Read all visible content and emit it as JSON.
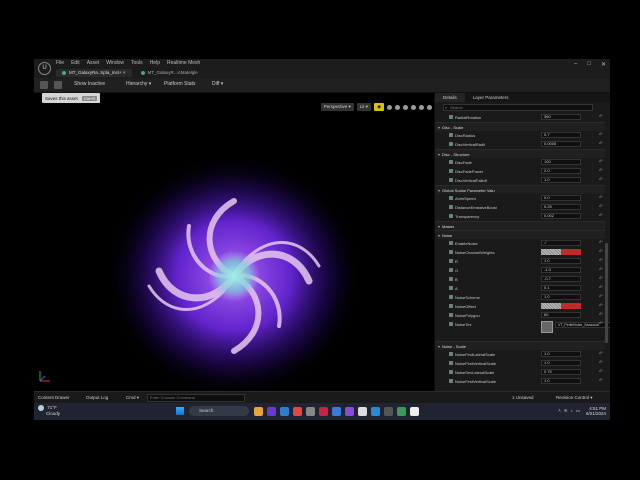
{
  "menu": [
    "File",
    "Edit",
    "Asset",
    "Window",
    "Tools",
    "Help",
    "Realtime Mesh"
  ],
  "doc_tabs": [
    {
      "label": "MT_GalaxyRa..Spla_Inst+ ×",
      "active": true
    },
    {
      "label": "MT_GalaxyR...icMatelgle",
      "active": false
    }
  ],
  "toolbar": {
    "show_inactive": "Show Inactive",
    "hierarchy": "Hierarchy ▾",
    "platform_stats": "Platform Stats",
    "diff": "Diff ▾"
  },
  "tooltip": {
    "text": "Saves this asset",
    "shortcut": "Ctrl+S"
  },
  "viewport": {
    "perspective": "Perspective ▾",
    "lit": "Lit ▾"
  },
  "bottombar": {
    "content_drawer": "Content Drawer",
    "output_log": "Output Log",
    "cmd": "Cmd ▾",
    "cmd_placeholder": "Enter Console Command",
    "unsaved": "1 Unsaved",
    "revision": "Revision Control ▾"
  },
  "panel": {
    "tabs": [
      "Details",
      "Layer Parameters"
    ],
    "search_placeholder": "Search",
    "rows": [
      {
        "kind": "param",
        "label": "RadialRotation",
        "value": "360"
      },
      {
        "kind": "section",
        "label": "Disc - Scale"
      },
      {
        "kind": "param",
        "label": "DiscRadius",
        "value": "0.7"
      },
      {
        "kind": "param",
        "label": "DiscVerticalRadii",
        "value": "0.0005"
      },
      {
        "kind": "section",
        "label": "Disc - Structure"
      },
      {
        "kind": "param",
        "label": "DiscFade",
        "value": "100"
      },
      {
        "kind": "param",
        "label": "DiscFadePower",
        "value": "2.0"
      },
      {
        "kind": "param",
        "label": "DiscVerticalFalloff",
        "value": "1.0"
      },
      {
        "kind": "section",
        "label": "Global Scalar Parameter Valu"
      },
      {
        "kind": "param",
        "label": "AnimSpeed",
        "value": "0.0"
      },
      {
        "kind": "param",
        "label": "DistanceEmissiveBoost",
        "value": "0.25"
      },
      {
        "kind": "param",
        "label": "Transparency",
        "value": "0.002"
      },
      {
        "kind": "section",
        "label": "Master"
      },
      {
        "kind": "section",
        "label": "Noise"
      },
      {
        "kind": "param",
        "label": "EnableNoise",
        "value": "✓"
      },
      {
        "kind": "color",
        "label": "NoiseChannelWeights"
      },
      {
        "kind": "param",
        "label": "R",
        "value": "1.0"
      },
      {
        "kind": "param",
        "label": "G",
        "value": "-1.0"
      },
      {
        "kind": "param",
        "label": "B",
        "value": "-0.7"
      },
      {
        "kind": "param",
        "label": "A",
        "value": "0.1"
      },
      {
        "kind": "param",
        "label": "NoiseScheme",
        "value": "1.0"
      },
      {
        "kind": "color",
        "label": "NoiseOffset"
      },
      {
        "kind": "param",
        "label": "NoisePolygon",
        "value": "60"
      },
      {
        "kind": "texture",
        "label": "NoiseTex",
        "value": "VT_PerlinNoise_Seasonal"
      },
      {
        "kind": "spacer"
      },
      {
        "kind": "section",
        "label": "Noise - Scale"
      },
      {
        "kind": "param",
        "label": "NoiseFirstLateralScale",
        "value": "1.0"
      },
      {
        "kind": "param",
        "label": "NoiseFirstVerticalScale",
        "value": "1.0"
      },
      {
        "kind": "param",
        "label": "NoiseSecLateralScale",
        "value": "0.75"
      },
      {
        "kind": "param",
        "label": "NoiseFirstVerticalScale",
        "value": "1.0"
      }
    ]
  },
  "taskbar": {
    "temp": "71°F",
    "condition": "Cloudy",
    "search": "Search",
    "time": "4:51 PM",
    "date": "6/21/2024"
  },
  "colors": {
    "accent": "#d8c400",
    "swatch_red": "#c02a2a",
    "galaxy_core": "#7fe0d8",
    "galaxy_glow": "#7a2cff"
  }
}
